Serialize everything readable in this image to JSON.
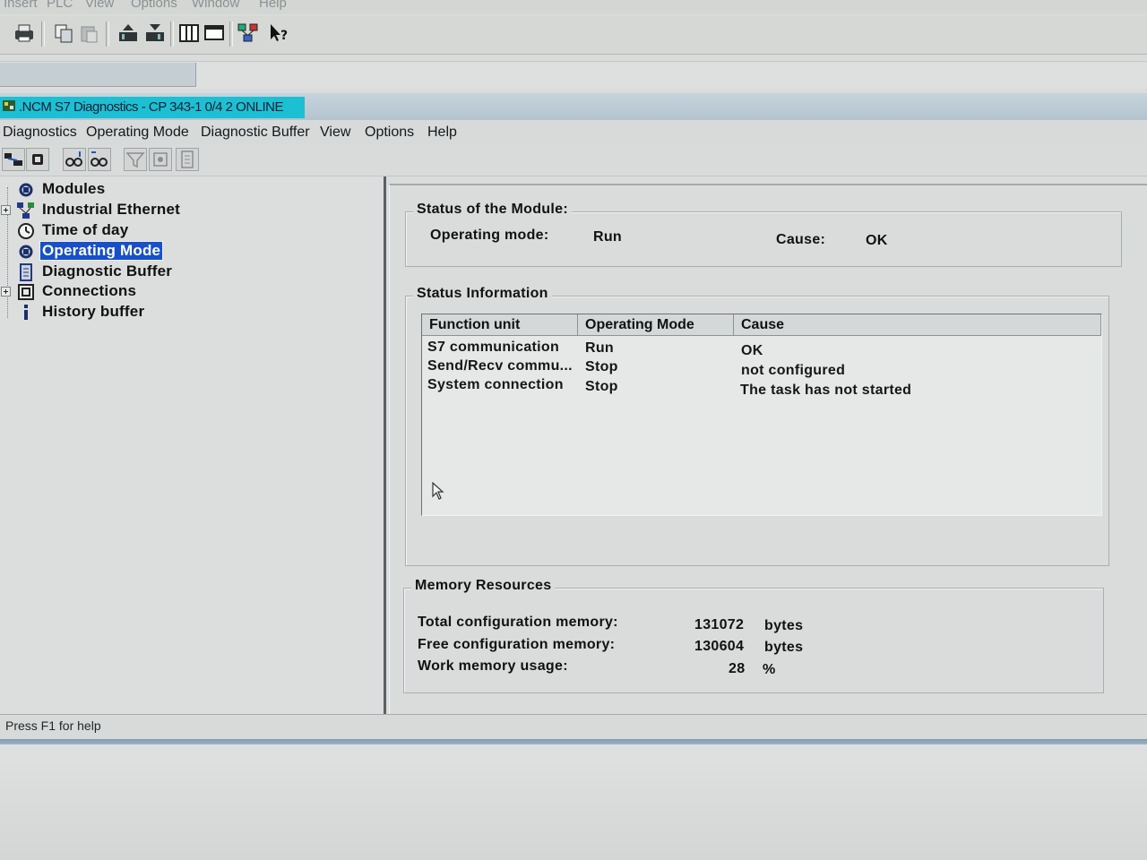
{
  "outer_app": {
    "menu": [
      "Insert",
      "PLC",
      "View",
      "Options",
      "Window",
      "Help"
    ]
  },
  "window": {
    "title": ".NCM S7 Diagnostics - CP 343-1 0/4 2  ONLINE"
  },
  "menubar": [
    "Diagnostics",
    "Operating Mode",
    "Diagnostic Buffer",
    "View",
    "Options",
    "Help"
  ],
  "tree": {
    "items": [
      {
        "label": "Modules",
        "icon": "modules-icon",
        "selected": false,
        "expandable": false
      },
      {
        "label": "Industrial Ethernet",
        "icon": "network-icon",
        "selected": false,
        "expandable": true
      },
      {
        "label": "Time of day",
        "icon": "clock-icon",
        "selected": false,
        "expandable": false
      },
      {
        "label": "Operating Mode",
        "icon": "operating-mode-icon",
        "selected": true,
        "expandable": false
      },
      {
        "label": "Diagnostic Buffer",
        "icon": "buffer-icon",
        "selected": false,
        "expandable": false
      },
      {
        "label": "Connections",
        "icon": "connections-icon",
        "selected": false,
        "expandable": true
      },
      {
        "label": "History buffer",
        "icon": "info-icon",
        "selected": false,
        "expandable": false
      }
    ]
  },
  "module_status": {
    "title": "Status of the Module:",
    "operating_mode_label": "Operating mode:",
    "operating_mode_value": "Run",
    "cause_label": "Cause:",
    "cause_value": "OK"
  },
  "status_information": {
    "title": "Status Information",
    "columns": [
      "Function unit",
      "Operating Mode",
      "Cause"
    ],
    "rows": [
      [
        "S7 communication",
        "Run",
        "OK"
      ],
      [
        "Send/Recv commu...",
        "Stop",
        "not configured"
      ],
      [
        "System connection",
        "Stop",
        "The task has not started"
      ]
    ]
  },
  "memory_resources": {
    "title": "Memory Resources",
    "rows": [
      {
        "label": "Total configuration memory:",
        "value": "131072",
        "unit": "bytes"
      },
      {
        "label": "Free configuration memory:",
        "value": "130604",
        "unit": "bytes"
      },
      {
        "label": "Work memory usage:",
        "value": "28",
        "unit": "%"
      }
    ]
  },
  "status_bar": {
    "text": "Press F1 for help"
  },
  "colors": {
    "selection": "#1750c9",
    "title_highlight": "#1dbfd3",
    "window_background": "#dadcdb"
  }
}
